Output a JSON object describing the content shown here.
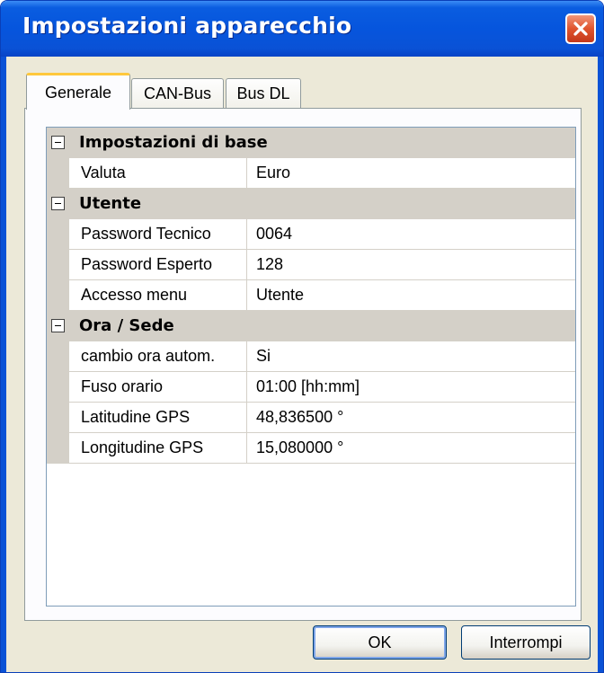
{
  "window": {
    "title": "Impostazioni apparecchio",
    "close_icon": "close-icon"
  },
  "tabs": [
    {
      "label": "Generale",
      "active": true
    },
    {
      "label": "CAN-Bus",
      "active": false
    },
    {
      "label": "Bus DL",
      "active": false
    }
  ],
  "grid": {
    "sections": [
      {
        "title": "Impostazioni di base",
        "expander_icon": "collapse-icon",
        "rows": [
          {
            "name": "Valuta",
            "value": "Euro"
          }
        ]
      },
      {
        "title": "Utente",
        "expander_icon": "collapse-icon",
        "rows": [
          {
            "name": "Password Tecnico",
            "value": "0064"
          },
          {
            "name": "Password Esperto",
            "value": "128"
          },
          {
            "name": "Accesso menu",
            "value": "Utente"
          }
        ]
      },
      {
        "title": "Ora / Sede",
        "expander_icon": "collapse-icon",
        "rows": [
          {
            "name": "cambio ora autom.",
            "value": "Si"
          },
          {
            "name": "Fuso orario",
            "value": "01:00 [hh:mm]"
          },
          {
            "name": "Latitudine GPS",
            "value": "48,836500 °"
          },
          {
            "name": "Longitudine GPS",
            "value": "15,080000 °"
          }
        ]
      }
    ]
  },
  "buttons": {
    "ok": "OK",
    "cancel": "Interrompi"
  },
  "colors": {
    "titlebar": "#0a5de0",
    "dialog_bg": "#ece9d8",
    "active_tab_accent": "#ffc83c",
    "category_bg": "#d4d0c8",
    "close_button": "#e0542e"
  }
}
